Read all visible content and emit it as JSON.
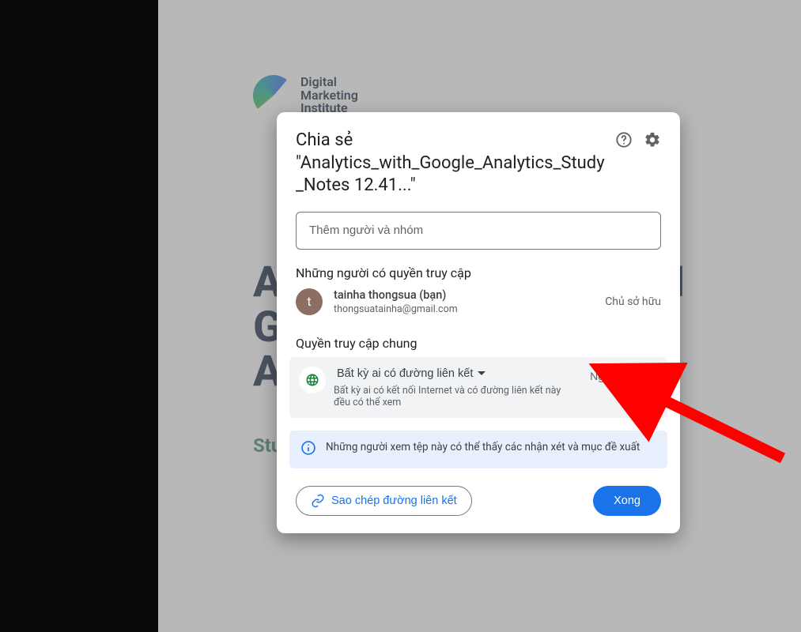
{
  "background": {
    "logo_line1": "Digital",
    "logo_line2": "Marketing",
    "logo_line3": "Institute",
    "title_line1": "A",
    "title_trail": "H",
    "title_line2": "G",
    "title_line3": "A",
    "subtitle_prefix": "Stu"
  },
  "dialog": {
    "title_prefix": "Chia sẻ",
    "title_filename": "\"Analytics_with_Google_Analytics_Study_Notes 12.41...\"",
    "input_placeholder": "Thêm người và nhóm",
    "people_section": "Những người có quyền truy cập",
    "owner": {
      "avatar_letter": "t",
      "name": "tainha thongsua (bạn)",
      "email": "thongsuatainha@gmail.com",
      "role": "Chủ sở hữu"
    },
    "general_section": "Quyền truy cập chung",
    "scope_label": "Bất kỳ ai có đường liên kết",
    "scope_desc": "Bất kỳ ai có kết nối Internet và có đường liên kết này đều có thể xem",
    "viewer_role": "Người xem",
    "note_text": "Những người xem tệp này có thể thấy các nhận xét và mục đề xuất",
    "copy_link": "Sao chép đường liên kết",
    "done": "Xong"
  },
  "annotation": {
    "arrow_color": "#ff0000"
  }
}
